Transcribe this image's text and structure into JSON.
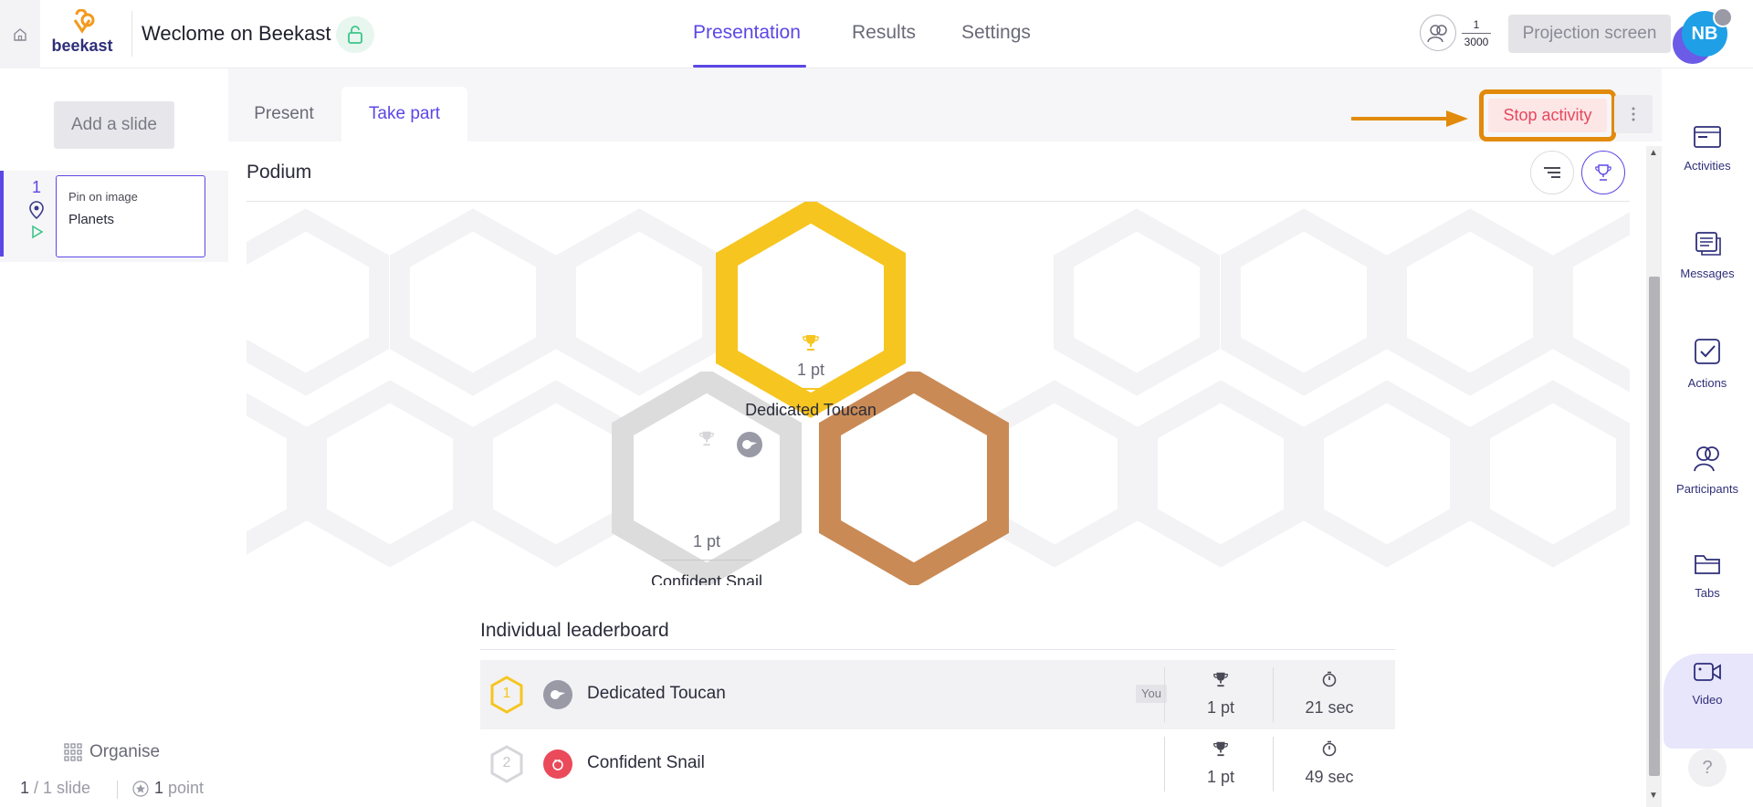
{
  "header": {
    "logo_text": "beekast",
    "title": "Weclome on Beekast",
    "tabs": [
      {
        "label": "Presentation",
        "active": true
      },
      {
        "label": "Results",
        "active": false
      },
      {
        "label": "Settings",
        "active": false
      }
    ],
    "participants_count": "1",
    "participants_max": "3000",
    "projection_label": "Projection screen",
    "avatar_initials": "NB"
  },
  "left": {
    "add_slide_label": "Add a slide",
    "slides": [
      {
        "number": "1",
        "type": "Pin on image",
        "name": "Planets"
      }
    ],
    "organise_label": "Organise",
    "slide_count_current": "1",
    "slide_count_text": " / 1 slide",
    "points_value": "1",
    "points_text": " point"
  },
  "main": {
    "subtabs": [
      {
        "label": "Present",
        "active": false
      },
      {
        "label": "Take part",
        "active": true
      }
    ],
    "stop_label": "Stop activity",
    "podium_title": "Podium",
    "podium": [
      {
        "rank": 1,
        "points": "1 pt",
        "name": "Dedicated Toucan",
        "color": "#f6c520"
      },
      {
        "rank": 2,
        "points": "1 pt",
        "name": "Confident Snail",
        "color": "#dcdcdc"
      },
      {
        "rank": 3,
        "points": "",
        "name": "",
        "color": "#c98a55"
      }
    ],
    "leaderboard_title": "Individual leaderboard",
    "leaderboard": [
      {
        "rank": "1",
        "name": "Dedicated Toucan",
        "you": "You",
        "points": "1 pt",
        "time": "21 sec",
        "avatar_color": "#9a9aa6",
        "rank_color": "#f6c520"
      },
      {
        "rank": "2",
        "name": "Confident Snail",
        "you": "",
        "points": "1 pt",
        "time": "49 sec",
        "avatar_color": "#ea4a5a",
        "rank_color": "#d6d6da"
      }
    ]
  },
  "right": {
    "items": [
      {
        "label": "Activities",
        "icon": "activities-icon"
      },
      {
        "label": "Messages",
        "icon": "messages-icon"
      },
      {
        "label": "Actions",
        "icon": "actions-icon"
      },
      {
        "label": "Participants",
        "icon": "participants-icon"
      },
      {
        "label": "Tabs",
        "icon": "tabs-icon"
      },
      {
        "label": "Video",
        "icon": "video-icon"
      }
    ],
    "help_label": "?"
  },
  "colors": {
    "accent": "#5b47e6",
    "gold": "#f6c520",
    "silver": "#dcdcdc",
    "bronze": "#c98a55",
    "stop_text": "#e5485d",
    "highlight_border": "#e18a0b"
  }
}
